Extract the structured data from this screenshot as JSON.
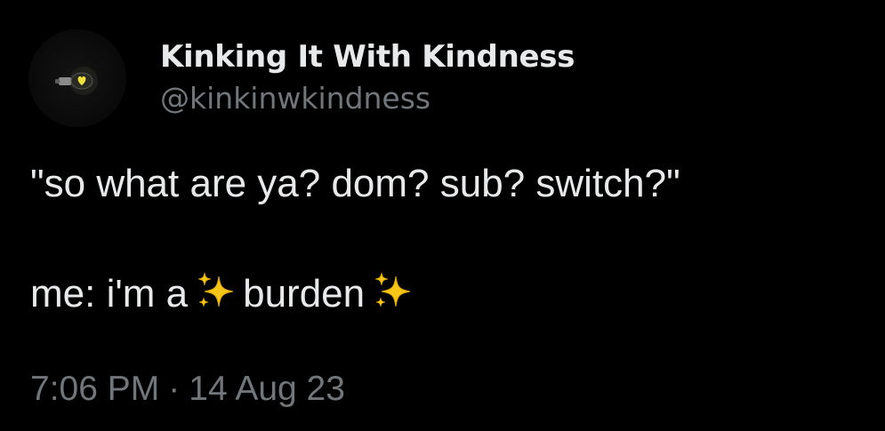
{
  "author": {
    "display_name": "Kinking It With Kindness",
    "handle": "@kinkinwkindness",
    "avatar_icon": "lightbulb-heart-icon"
  },
  "tweet": {
    "line1": "\"so what are ya? dom? sub? switch?\"",
    "line2_prefix": "me: i'm a",
    "line2_word": "burden",
    "sparkle_icon": "sparkles-emoji"
  },
  "meta": {
    "time": "7:06 PM",
    "separator": "·",
    "date": "14 Aug 23"
  },
  "colors": {
    "background": "#000000",
    "primary_text": "#e7e9ea",
    "secondary_text": "#71767b",
    "sparkle": "#f5c518"
  }
}
